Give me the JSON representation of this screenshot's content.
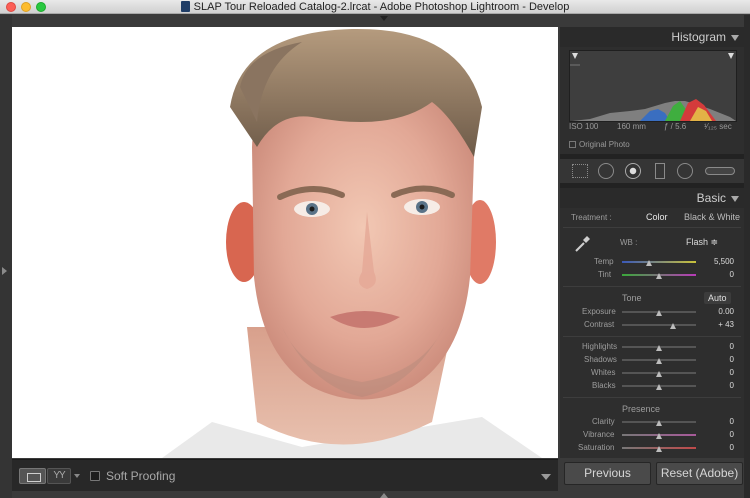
{
  "window": {
    "title": "SLAP Tour Reloaded Catalog-2.lrcat - Adobe Photoshop Lightroom - Develop"
  },
  "toolbar": {
    "yy_label": "YY",
    "soft_proofing_label": "Soft Proofing"
  },
  "histogram": {
    "title": "Histogram",
    "iso": "ISO 100",
    "focal": "160 mm",
    "aperture": "ƒ / 5.6",
    "shutter": "¹⁄₁₂₅ sec",
    "original_photo_label": "Original Photo"
  },
  "basic": {
    "title": "Basic",
    "treatment_label": "Treatment :",
    "treatment_color": "Color",
    "treatment_bw": "Black & White",
    "wb_label": "WB :",
    "wb_value": "Flash ≑",
    "temp_label": "Temp",
    "temp_value": "5,500",
    "tint_label": "Tint",
    "tint_value": "0",
    "tone_label": "Tone",
    "auto_label": "Auto",
    "exposure_label": "Exposure",
    "exposure_value": "0.00",
    "contrast_label": "Contrast",
    "contrast_value": "+ 43",
    "highlights_label": "Highlights",
    "highlights_value": "0",
    "shadows_label": "Shadows",
    "shadows_value": "0",
    "whites_label": "Whites",
    "whites_value": "0",
    "blacks_label": "Blacks",
    "blacks_value": "0",
    "presence_label": "Presence",
    "clarity_label": "Clarity",
    "clarity_value": "0",
    "vibrance_label": "Vibrance",
    "vibrance_value": "0",
    "saturation_label": "Saturation",
    "saturation_value": "0"
  },
  "buttons": {
    "previous": "Previous",
    "reset": "Reset (Adobe)"
  },
  "colors": {
    "panel_bg": "#2e2e2e",
    "header_bg": "#2a2a2a",
    "photo_bg": "#ffffff"
  },
  "icons": [
    "crop-icon",
    "spot-removal-icon",
    "red-eye-icon",
    "graduated-filter-icon",
    "radial-filter-icon",
    "adjustment-brush-icon",
    "eyedropper-icon"
  ]
}
